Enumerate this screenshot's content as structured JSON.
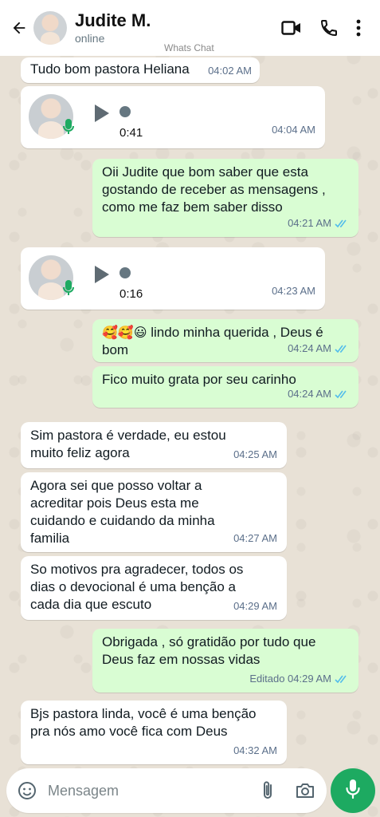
{
  "header": {
    "name": "Judite M.",
    "status": "online",
    "watermark": "Whats Chat"
  },
  "messages": [
    {
      "dir": "in",
      "text": "Tudo bom pastora Heliana",
      "time": "04:02 AM"
    },
    {
      "dir": "in",
      "type": "voice",
      "duration": "0:41",
      "time": "04:04 AM"
    },
    {
      "dir": "out",
      "text": "Oii Judite que bom saber que esta\ngostando  de receber as mensagens ,\ncomo me faz bem saber disso",
      "time": "04:21 AM"
    },
    {
      "dir": "in",
      "type": "voice",
      "duration": "0:16",
      "time": "04:23 AM"
    },
    {
      "dir": "out",
      "emoji": "🥰🥰😃",
      "text": " lindo minha querida , Deus é\nbom",
      "time": "04:24 AM"
    },
    {
      "dir": "out",
      "text": "Fico muito grata por seu carinho",
      "time": "04:24 AM"
    },
    {
      "dir": "in",
      "text": "Sim pastora é verdade, eu estou\nmuito feliz agora",
      "time": "04:25 AM"
    },
    {
      "dir": "in",
      "text": "Agora sei que posso voltar a\nacreditar pois Deus esta me\ncuidando e cuidando da minha\nfamilia",
      "time": "04:27 AM"
    },
    {
      "dir": "in",
      "text": "So motivos pra agradecer, todos os\ndias o devocional é uma benção a\ncada dia que escuto",
      "time": "04:29 AM"
    },
    {
      "dir": "out",
      "text": "Obrigada , só gratidão por tudo que\nDeus faz em nossas vidas",
      "time": "Editado 04:29 AM"
    },
    {
      "dir": "in",
      "text": "Bjs pastora linda, você é uma benção\npra nós amo você fica com Deus",
      "time": "04:32 AM"
    }
  ],
  "input": {
    "placeholder": "Mensagem"
  },
  "colors": {
    "outgoing_bubble": "#d9fdd3",
    "incoming_bubble": "#ffffff",
    "accent_green": "#1daa61",
    "read_ticks": "#53bdeb"
  }
}
